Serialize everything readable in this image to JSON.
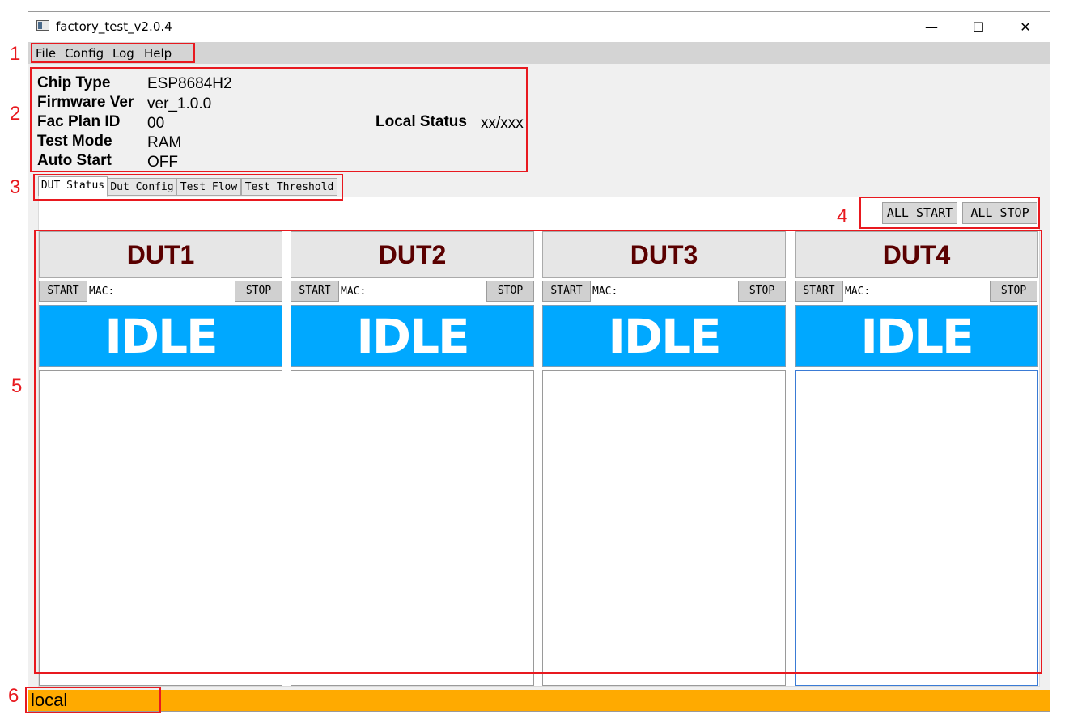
{
  "window": {
    "title": "factory_test_v2.0.4"
  },
  "menu": [
    "File",
    "Config",
    "Log",
    "Help"
  ],
  "info": {
    "rows": [
      {
        "label": "Chip Type",
        "value": "ESP8684H2"
      },
      {
        "label": "Firmware Ver",
        "value": "ver_1.0.0"
      },
      {
        "label": "Fac Plan ID",
        "value": "00"
      },
      {
        "label": "Test Mode",
        "value": "RAM"
      },
      {
        "label": "Auto Start",
        "value": "OFF"
      }
    ],
    "local_status_label": "Local Status",
    "local_status_value": "xx/xxx"
  },
  "tabs": [
    "DUT Status",
    "Dut Config",
    "Test Flow",
    "Test Threshold"
  ],
  "toolbar": {
    "all_start": "ALL START",
    "all_stop": "ALL STOP"
  },
  "duts": [
    {
      "name": "DUT1",
      "start": "START",
      "mac_label": "MAC:",
      "stop": "STOP",
      "state": "IDLE"
    },
    {
      "name": "DUT2",
      "start": "START",
      "mac_label": "MAC:",
      "stop": "STOP",
      "state": "IDLE"
    },
    {
      "name": "DUT3",
      "start": "START",
      "mac_label": "MAC:",
      "stop": "STOP",
      "state": "IDLE"
    },
    {
      "name": "DUT4",
      "start": "START",
      "mac_label": "MAC:",
      "stop": "STOP",
      "state": "IDLE"
    }
  ],
  "statusbar": {
    "text": "local"
  },
  "annotations": [
    "1",
    "2",
    "3",
    "4",
    "5",
    "6"
  ],
  "colors": {
    "idle": "#00a8ff",
    "status_bar": "#ffaa00",
    "dut_title": "#5a0000",
    "annotation": "#e8191f"
  }
}
